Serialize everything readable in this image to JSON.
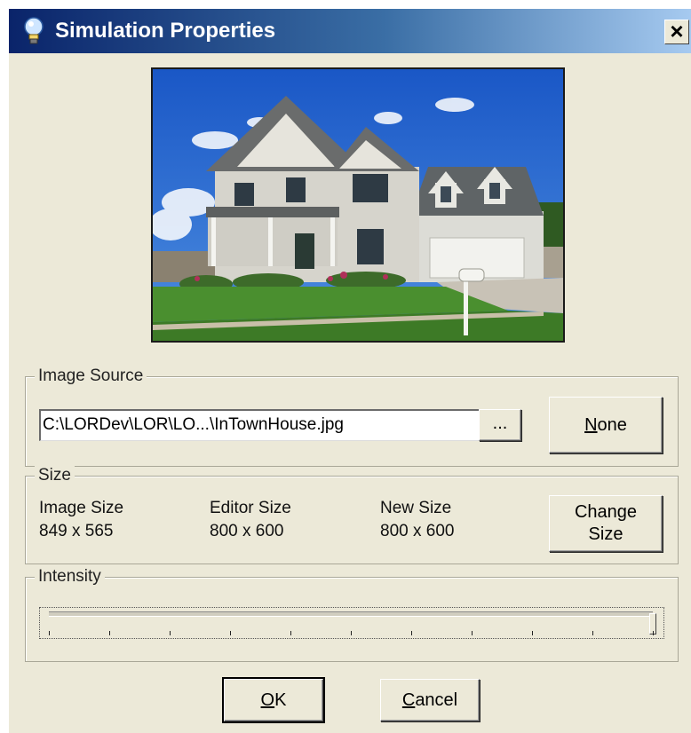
{
  "window": {
    "title": "Simulation Properties",
    "title_icon": "lightbulb-icon",
    "close_label": "×",
    "close_icon": "close-icon"
  },
  "preview": {
    "description_icon": "house-photo-preview"
  },
  "image_source": {
    "label": "Image Source",
    "path_value": "C:\\LORDev\\LOR\\LO...\\InTownHouse.jpg",
    "browse_label": "...",
    "none_label_mnemonic": "N",
    "none_label_rest": "one"
  },
  "size": {
    "label": "Size",
    "image_size_label": "Image Size",
    "image_size_value": "849 x 565",
    "editor_size_label": "Editor Size",
    "editor_size_value": "800 x 600",
    "new_size_label": "New Size",
    "new_size_value": "800 x 600",
    "change_size_line1": "Change",
    "change_size_line2": "Size"
  },
  "intensity": {
    "label": "Intensity",
    "value_fraction": 1.0,
    "tick_count": 11
  },
  "footer": {
    "ok_mnemonic": "O",
    "ok_rest": "K",
    "cancel_mnemonic": "C",
    "cancel_rest": "ancel"
  },
  "colors": {
    "titlebar_start": "#0a246a",
    "titlebar_end": "#a6caf0",
    "dialog_bg": "#ece9d8"
  }
}
